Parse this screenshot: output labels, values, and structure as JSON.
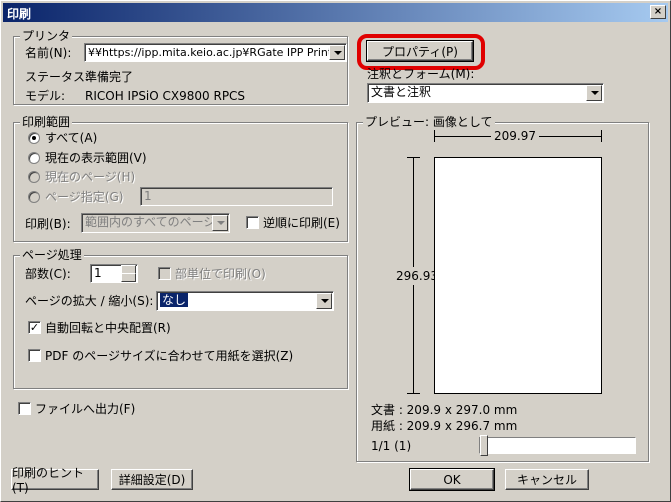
{
  "window": {
    "title": "印刷",
    "close_glyph": "×"
  },
  "printer": {
    "group_label": "プリンタ",
    "name_label": "名前(N):",
    "name_value": "¥¥https://ipp.mita.keio.ac.jp¥RGate IPP Printer",
    "status_label": "ステータス:",
    "status_value": "準備完了",
    "model_label": "モデル:",
    "model_value": "RICOH IPSiO CX9800 RPCS",
    "properties_button": "プロパティ(P)",
    "comments_forms_label": "注釈とフォーム(M):",
    "comments_forms_value": "文書と注釈"
  },
  "print_range": {
    "group_label": "印刷範囲",
    "all": "すべて(A)",
    "current_view": "現在の表示範囲(V)",
    "current_page": "現在のページ(H)",
    "pages": "ページ指定(G)",
    "pages_value": "1",
    "subset_label": "印刷(B):",
    "subset_value": "範囲内のすべてのページ",
    "reverse": "逆順に印刷(E)"
  },
  "page_handling": {
    "group_label": "ページ処理",
    "copies_label": "部数(C):",
    "copies_value": "1",
    "collate": "部単位で印刷(O)",
    "scaling_label": "ページの拡大 / 縮小(S):",
    "scaling_value": "なし",
    "auto_rotate": "自動回転と中央配置(R)",
    "choose_paper": "PDF のページサイズに合わせて用紙を選択(Z)",
    "auto_rotate_checked": true,
    "choose_paper_checked": false
  },
  "print_to_file": "ファイルへ出力(F)",
  "preview": {
    "group_label": "プレビュー: 画像として",
    "width": "209.97",
    "height": "296.93",
    "doc_label": "文書 : 209.9 x 297.0 mm",
    "paper_label": "用紙 : 209.9 x 296.7 mm",
    "page_counter": "1/1 (1)"
  },
  "buttons": {
    "tips": "印刷のヒント(T)",
    "advanced": "詳細設定(D)",
    "ok": "OK",
    "cancel": "キャンセル"
  },
  "colors": {
    "titlebar": "#0a246a",
    "highlight": "#e00000",
    "face": "#d4d0c8"
  }
}
